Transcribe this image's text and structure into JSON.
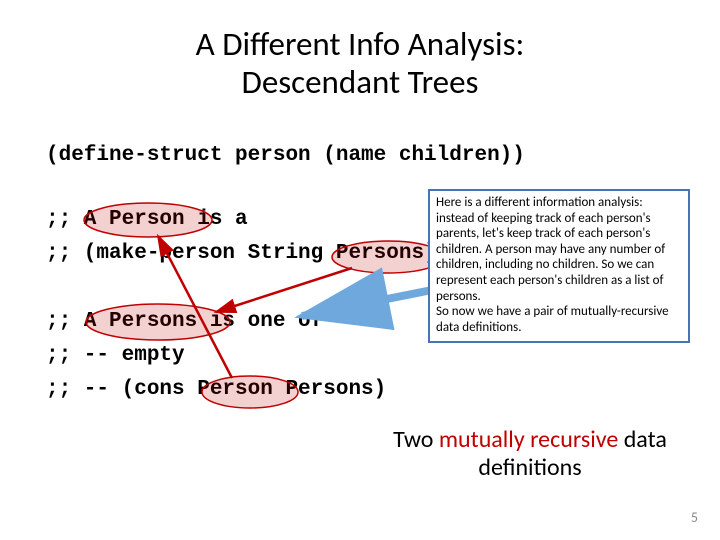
{
  "title_line1": "A Different Info Analysis:",
  "title_line2": "Descendant Trees",
  "code": {
    "l1": "(define-struct person (name children))",
    "l2": ";; A Person is a",
    "l3": ";; (make-person String Persons)",
    "l4": ";; A Persons is one of",
    "l5": ";; -- empty",
    "l6": ";; -- (cons Person Persons)"
  },
  "callout": {
    "p1": "Here is a different information analysis: instead of keeping track of each person's parents, let's keep track of each person's children.  A person may have any number of children, including no children.  So we can represent each person's children as a list of persons.",
    "p2": "So now we have a pair of mutually-recursive data definitions."
  },
  "caption_before": "Two ",
  "caption_accent": "mutually recursive",
  "caption_after": " data definitions",
  "page": "5"
}
